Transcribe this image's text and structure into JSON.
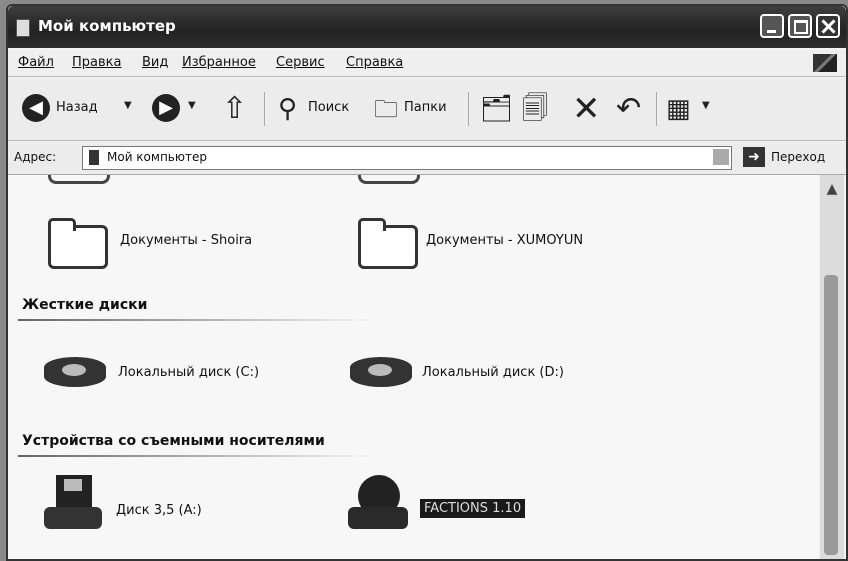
{
  "window": {
    "title": "Мой компьютер"
  },
  "menu": [
    "Файл",
    "Правка",
    "Вид",
    "Избранное",
    "Сервис",
    "Справка"
  ],
  "toolbar": {
    "back": "Назад",
    "search": "Поиск",
    "folders": "Папки"
  },
  "address": {
    "label": "Адрес:",
    "value": "Мой компьютер",
    "go": "Переход"
  },
  "groups": {
    "hard_drives": "Жесткие диски",
    "removable": "Устройства со съемными носителями"
  },
  "items": {
    "docs_shoira": "Документы - Shoira",
    "docs_xumoyun": "Документы - XUMOYUN",
    "disk_c": "Локальный диск (C:)",
    "disk_d": "Локальный диск (D:)",
    "floppy_a": "Диск 3,5 (A:)",
    "cd_drive": "FACTIONS 1.10"
  },
  "icons": {
    "back": "back-arrow-icon",
    "forward": "forward-arrow-icon",
    "up": "up-folder-icon",
    "search": "search-icon",
    "folders": "folders-icon",
    "move": "move-to-icon",
    "copy": "copy-to-icon",
    "delete": "delete-icon",
    "undo": "undo-icon",
    "views": "views-icon"
  }
}
